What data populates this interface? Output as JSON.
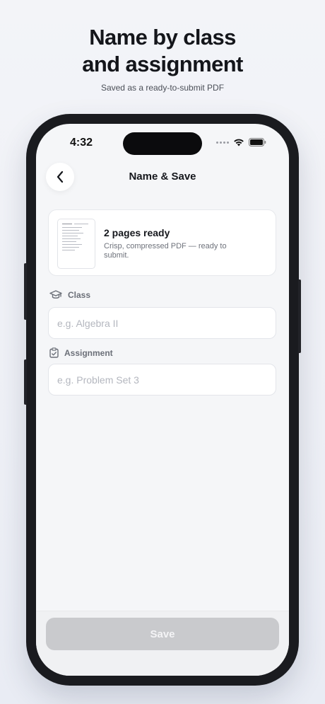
{
  "marketing": {
    "headline_line1": "Name by class",
    "headline_line2": "and assignment",
    "subheadline": "Saved as a ready-to-submit PDF"
  },
  "status_bar": {
    "time": "4:32",
    "icons": [
      "cellular-dots-icon",
      "wifi-icon",
      "battery-icon"
    ]
  },
  "nav": {
    "back_icon": "chevron-left-icon",
    "title": "Name & Save"
  },
  "document_card": {
    "title": "2 pages ready",
    "description": "Crisp, compressed PDF — ready to submit.",
    "thumbnail_icon": "document-thumbnail"
  },
  "form": {
    "class": {
      "icon": "graduation-cap-icon",
      "label": "Class",
      "value": "",
      "placeholder": "e.g. Algebra II"
    },
    "assignment": {
      "icon": "clipboard-check-icon",
      "label": "Assignment",
      "value": "",
      "placeholder": "e.g. Problem Set 3"
    }
  },
  "footer": {
    "save_label": "Save",
    "save_enabled": false
  },
  "colors": {
    "background": "#f3f4f8",
    "phone_frame": "#1a1b1f",
    "screen_bg": "#f5f6f8",
    "save_disabled": "#c9cacd",
    "text_primary": "#15171c",
    "text_secondary": "#6e727b"
  }
}
